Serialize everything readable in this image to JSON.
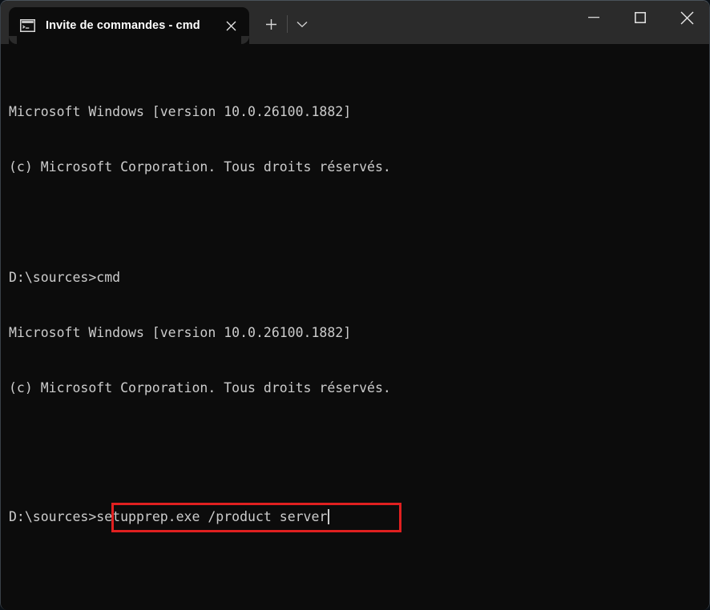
{
  "window": {
    "title": "Invite de commandes - cmd",
    "background_color": "#0c0c0c",
    "titlebar_color": "#2b2b2b",
    "text_color": "#cccccc",
    "accent_highlight_color": "#e02020"
  },
  "titlebar": {
    "tab": {
      "label": "Invite de commandes - cmd",
      "icon": "console-icon",
      "close_glyph": "✕"
    },
    "new_tab_glyph": "+",
    "tab_menu_glyph": "⌄",
    "caption_buttons": {
      "minimize_glyph": "‒",
      "maximize_glyph": "□",
      "close_glyph": "✕"
    }
  },
  "terminal": {
    "lines": [
      {
        "text": "Microsoft Windows [version 10.0.26100.1882]"
      },
      {
        "text": "(c) Microsoft Corporation. Tous droits réservés."
      },
      {
        "text": ""
      },
      {
        "text": "D:\\sources>cmd"
      },
      {
        "text": "Microsoft Windows [version 10.0.26100.1882]"
      },
      {
        "text": "(c) Microsoft Corporation. Tous droits réservés."
      },
      {
        "text": ""
      }
    ],
    "prompt": {
      "path": "D:\\sources>",
      "command": "setupprep.exe /product server",
      "highlighted": true,
      "cursor_visible": true
    }
  }
}
